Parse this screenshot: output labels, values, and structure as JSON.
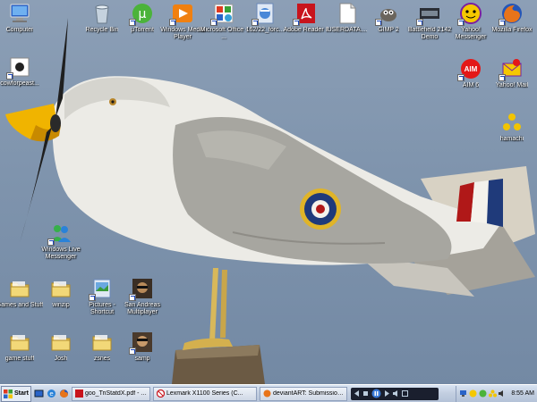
{
  "desktop": {
    "icons": [
      {
        "label": "Computer",
        "icon": "computer-icon"
      },
      {
        "label": "Recycle Bin",
        "icon": "recycle-bin-icon"
      },
      {
        "label": "µTorrent",
        "icon": "utorrent-icon"
      },
      {
        "label": "Windows Media Player",
        "icon": "windows-media-player-icon"
      },
      {
        "label": "Microsoft Office - ...",
        "icon": "microsoft-office-icon"
      },
      {
        "label": "162/22_forc...",
        "icon": "file-icon"
      },
      {
        "label": "Adobe Reader 8",
        "icon": "adobe-reader-icon"
      },
      {
        "label": "USERDATA....",
        "icon": "document-icon"
      },
      {
        "label": "GIMP 2",
        "icon": "gimp-icon"
      },
      {
        "label": "Battlefield 2142 Demo",
        "icon": "battlefield-icon"
      },
      {
        "label": "Yahoo! Messenger",
        "icon": "yahoo-messenger-icon"
      },
      {
        "label": "Mozilla Firefox",
        "icon": "firefox-icon"
      },
      {
        "label": "cowforpeast...",
        "icon": "image-file-icon"
      },
      {
        "label": "AIM 6",
        "icon": "aim-icon"
      },
      {
        "label": "Yahoo! Mail",
        "icon": "yahoo-mail-icon"
      },
      {
        "label": "hamachi",
        "icon": "hamachi-icon"
      },
      {
        "label": "Windows Live Messenger",
        "icon": "windows-live-messenger-icon"
      },
      {
        "label": "Games and Stuff",
        "icon": "folder-icon"
      },
      {
        "label": "winzip",
        "icon": "folder-icon"
      },
      {
        "label": "Pictures - Shortcut",
        "icon": "pictures-icon"
      },
      {
        "label": "San Andreas Multiplayer",
        "icon": "san-andreas-icon"
      },
      {
        "label": "game stuff",
        "icon": "folder-icon"
      },
      {
        "label": "Josh",
        "icon": "folder-icon"
      },
      {
        "label": "zsnes",
        "icon": "folder-icon"
      },
      {
        "label": "samp",
        "icon": "samp-icon"
      }
    ]
  },
  "taskbar": {
    "start_label": "Start",
    "tasks": [
      {
        "label": "goo_TriStatdX.pdf - Ado...",
        "icon": "adobe-reader-icon"
      },
      {
        "label": "Lexmark X1100 Series (C...",
        "icon": "lexmark-icon"
      },
      {
        "label": "deviantART: Submission ...",
        "icon": "firefox-icon"
      }
    ],
    "clock": "8:55 AM"
  },
  "colors": {
    "sky": "#7f94ad",
    "taskbar": "#c2cee0",
    "roundel_blue": "#1f3a7a",
    "roundel_red": "#b01818",
    "beak": "#f0b400"
  }
}
